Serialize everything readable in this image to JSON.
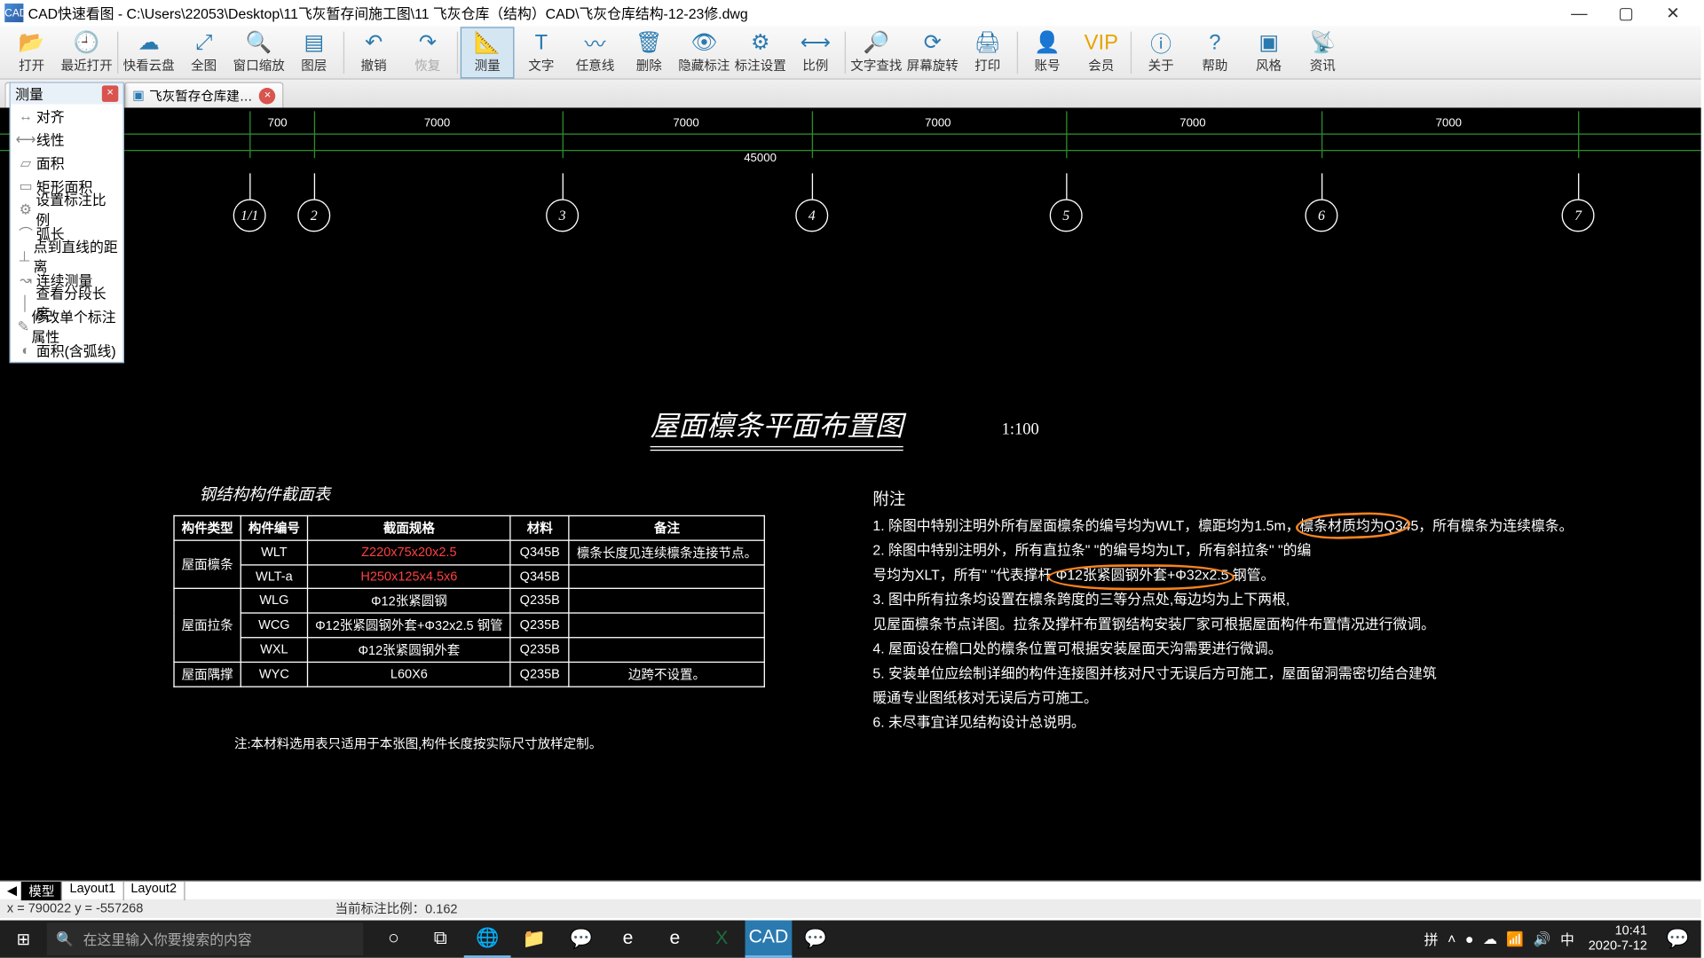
{
  "title": "CAD快速看图 - C:\\Users\\22053\\Desktop\\11飞灰暂存间施工图\\11 飞灰仓库（结构）CAD\\飞灰仓库结构-12-23修.dwg",
  "toolbar": [
    {
      "label": "打开",
      "icon": "📂"
    },
    {
      "label": "最近打开",
      "icon": "🕘"
    },
    {
      "label": "快看云盘",
      "icon": "☁"
    },
    {
      "label": "全图",
      "icon": "⤢"
    },
    {
      "label": "窗口缩放",
      "icon": "🔍"
    },
    {
      "label": "图层",
      "icon": "▤"
    },
    {
      "label": "撤销",
      "icon": "↶"
    },
    {
      "label": "恢复",
      "icon": "↷",
      "disabled": true
    },
    {
      "label": "测量",
      "icon": "📐",
      "active": true
    },
    {
      "label": "文字",
      "icon": "T"
    },
    {
      "label": "任意线",
      "icon": "〰"
    },
    {
      "label": "删除",
      "icon": "🗑"
    },
    {
      "label": "隐藏标注",
      "icon": "👁"
    },
    {
      "label": "标注设置",
      "icon": "⚙"
    },
    {
      "label": "比例",
      "icon": "⟷"
    },
    {
      "label": "文字查找",
      "icon": "🔎"
    },
    {
      "label": "屏幕旋转",
      "icon": "⟳"
    },
    {
      "label": "打印",
      "icon": "🖨"
    },
    {
      "label": "账号",
      "icon": "👤"
    },
    {
      "label": "会员",
      "icon": "VIP",
      "vip": true
    },
    {
      "label": "关于",
      "icon": "ⓘ"
    },
    {
      "label": "帮助",
      "icon": "?"
    },
    {
      "label": "风格",
      "icon": "▣"
    },
    {
      "label": "资讯",
      "icon": "📡"
    }
  ],
  "dropdown": {
    "title": "测量",
    "items": [
      "对齐",
      "线性",
      "面积",
      "矩形面积",
      "设置标注比例",
      "弧长",
      "点到直线的距离",
      "连续测量",
      "查看分段长度",
      "修改单个标注属性",
      "面积(含弧线)"
    ]
  },
  "tabs": [
    {
      "label": "飞灰暂存仓库建…",
      "active": false
    }
  ],
  "drawing": {
    "title": "屋面檩条平面布置图",
    "scale": "1:100",
    "top_dims": [
      "700",
      "7000",
      "7000",
      "7000",
      "7000",
      "7000",
      "7000"
    ],
    "overall": "45000",
    "axes": [
      "1/1",
      "2",
      "3",
      "4",
      "5",
      "6",
      "7"
    ]
  },
  "spec_title": "钢结构构件截面表",
  "spec_headers": [
    "构件类型",
    "构件编号",
    "截面规格",
    "材料",
    "备注"
  ],
  "spec_rows": [
    {
      "type": "屋面檩条",
      "span": 2,
      "num": "WLT",
      "spec": "Z220x75x20x2.5",
      "mat": "Q345B",
      "note": "檩条长度见连续檩条连接节点。",
      "red": true
    },
    {
      "num": "WLT-a",
      "spec": "H250x125x4.5x6",
      "mat": "Q345B",
      "note": "",
      "red": true
    },
    {
      "type": "屋面拉条",
      "span": 3,
      "num": "WLG",
      "spec": "Φ12张紧圆钢",
      "mat": "Q235B",
      "note": ""
    },
    {
      "num": "WCG",
      "spec": "Φ12张紧圆钢外套+Φ32x2.5 钢管",
      "mat": "Q235B",
      "note": ""
    },
    {
      "num": "WXL",
      "spec": "Φ12张紧圆钢外套",
      "mat": "Q235B",
      "note": ""
    },
    {
      "type": "屋面隅撑",
      "span": 1,
      "num": "WYC",
      "spec": "L60X6",
      "mat": "Q235B",
      "note": "边跨不设置。"
    }
  ],
  "spec_note": "注:本材料选用表只适用于本张图,构件长度按实际尺寸放样定制。",
  "notes": {
    "title": "附注",
    "lines": [
      "1. 除图中特别注明外所有屋面檩条的编号均为WLT，檩距均为1.5m，檩条材质均为Q345，所有檩条为连续檩条。",
      "2. 除图中特别注明外，所有直拉条\"   \"的编号均为LT，所有斜拉条\"    \"的编",
      "   号均为XLT，所有\"   \"代表撑杆 Φ12张紧圆钢外套+Φ32x2.5 钢管。",
      "3. 图中所有拉条均设置在檩条跨度的三等分点处,每边均为上下两根,",
      "   见屋面檩条节点详图。拉条及撑杆布置钢结构安装厂家可根据屋面构件布置情况进行微调。",
      "4. 屋面设在檐口处的檩条位置可根据安装屋面天沟需要进行微调。",
      "5. 安装单位应绘制详细的构件连接图并核对尺寸无误后方可施工，屋面留洞需密切结合建筑",
      "   暖通专业图纸核对无误后方可施工。",
      "6. 未尽事宜详见结构设计总说明。"
    ]
  },
  "layout_tabs": [
    "模型",
    "Layout1",
    "Layout2"
  ],
  "status": {
    "coords": "x = 790022  y = -557268",
    "scale": "当前标注比例：0.162"
  },
  "taskbar": {
    "search_placeholder": "在这里输入你要搜索的内容",
    "time": "10:41",
    "date": "2020-7-12"
  }
}
